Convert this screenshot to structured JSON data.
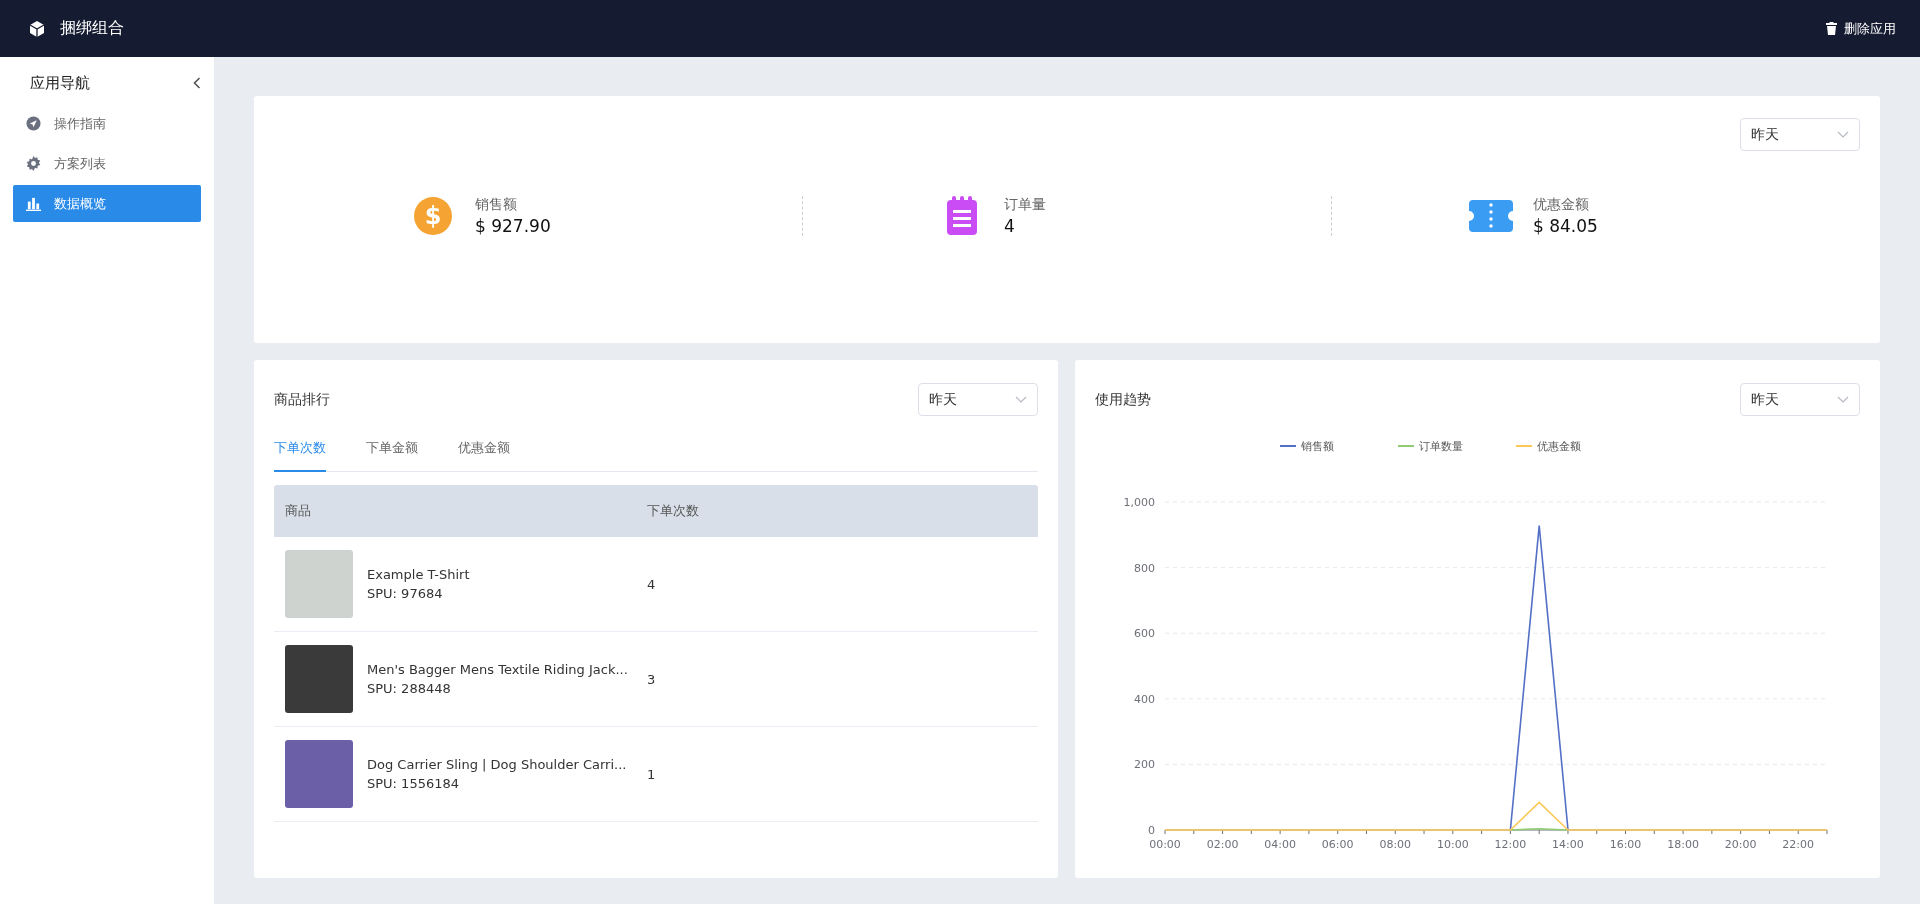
{
  "app": {
    "title": "捆绑组合",
    "delete_label": "删除应用"
  },
  "sidebar": {
    "title": "应用导航",
    "items": [
      {
        "label": "操作指南",
        "selected": false
      },
      {
        "label": "方案列表",
        "selected": false
      },
      {
        "label": "数据概览",
        "selected": true
      }
    ]
  },
  "summary": {
    "period": "昨天",
    "stats": [
      {
        "label": "销售额",
        "value": "$ 927.90",
        "color": "#f5a332",
        "icon_glyph": "$"
      },
      {
        "label": "订单量",
        "value": "4",
        "color": "#c94cf5"
      },
      {
        "label": "优惠金额",
        "value": "$ 84.05",
        "color": "#3a9cf2"
      }
    ]
  },
  "ranking": {
    "title": "商品排行",
    "period": "昨天",
    "tabs": [
      {
        "label": "下单次数",
        "selected": true
      },
      {
        "label": "下单金额",
        "selected": false
      },
      {
        "label": "优惠金额",
        "selected": false
      }
    ],
    "columns": [
      "商品",
      "下单次数"
    ],
    "rows": [
      {
        "name": "Example T-Shirt",
        "spu": "SPU: 97684",
        "count": "4"
      },
      {
        "name": "Men's Bagger Mens Textile Riding Jack...",
        "spu": "SPU: 288448",
        "count": "3"
      },
      {
        "name": "Dog Carrier Sling | Dog Shoulder Carri...",
        "spu": "SPU: 1556184",
        "count": "1"
      }
    ]
  },
  "trend": {
    "title": "使用趋势",
    "period": "昨天",
    "chart_data": {
      "type": "line",
      "x": [
        0,
        1,
        2,
        3,
        4,
        5,
        6,
        7,
        8,
        9,
        10,
        11,
        12,
        13,
        14,
        15,
        16,
        17,
        18,
        19,
        20,
        21,
        22,
        23
      ],
      "xlim": [
        0,
        23
      ],
      "xticks": [
        {
          "value": 0,
          "label": "00:00"
        },
        {
          "value": 2,
          "label": "02:00"
        },
        {
          "value": 4,
          "label": "04:00"
        },
        {
          "value": 6,
          "label": "06:00"
        },
        {
          "value": 8,
          "label": "08:00"
        },
        {
          "value": 10,
          "label": "10:00"
        },
        {
          "value": 12,
          "label": "12:00"
        },
        {
          "value": 14,
          "label": "14:00"
        },
        {
          "value": 16,
          "label": "16:00"
        },
        {
          "value": 18,
          "label": "18:00"
        },
        {
          "value": 20,
          "label": "20:00"
        },
        {
          "value": 22,
          "label": "22:00"
        }
      ],
      "ylim": [
        0,
        1000
      ],
      "grid": true,
      "legend": "top",
      "yticks": [
        0,
        200,
        400,
        600,
        800,
        {
          "value": 1000,
          "label": "1,000"
        }
      ],
      "series": [
        {
          "name": "销售额",
          "color": "#5470c6",
          "values": [
            null,
            null,
            null,
            null,
            null,
            null,
            null,
            null,
            null,
            null,
            null,
            null,
            0,
            928,
            0,
            null,
            null,
            null,
            null,
            null,
            null,
            null,
            null,
            null
          ]
        },
        {
          "name": "订单数量",
          "color": "#91cc75",
          "values": [
            null,
            null,
            null,
            null,
            null,
            null,
            null,
            null,
            null,
            null,
            null,
            null,
            0,
            4,
            0,
            null,
            null,
            null,
            null,
            null,
            null,
            null,
            null,
            null
          ]
        },
        {
          "name": "优惠金额",
          "color": "#fac858",
          "values": [
            0,
            0,
            0,
            0,
            0,
            0,
            0,
            0,
            0,
            0,
            0,
            0,
            0,
            84,
            0,
            0,
            0,
            0,
            0,
            0,
            0,
            0,
            0,
            0
          ]
        }
      ]
    }
  }
}
